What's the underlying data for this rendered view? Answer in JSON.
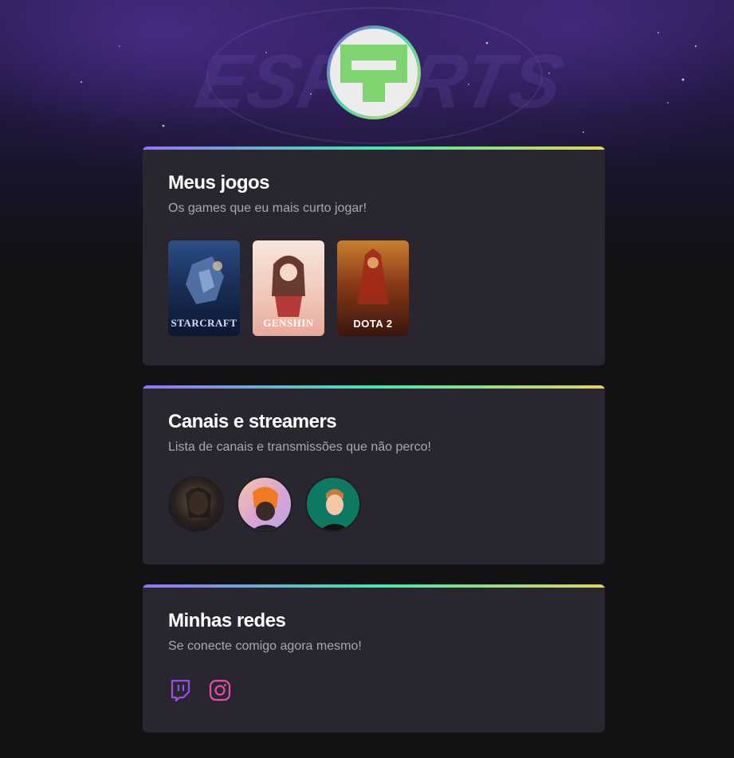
{
  "profile": {
    "avatar_icon": "pin-logo-icon",
    "brand_color": "#7ed56f"
  },
  "sections": {
    "games": {
      "title": "Meus jogos",
      "subtitle": "Os games que eu mais curto jogar!",
      "items": [
        {
          "name": "StarCraft II",
          "label": "STARCRAFT",
          "color": "#1b3a6b"
        },
        {
          "name": "Genshin Impact",
          "label": "GENSHIN",
          "color": "#f3d6c9"
        },
        {
          "name": "Dota 2",
          "label": "DOTA 2",
          "color": "#7a2a14"
        }
      ]
    },
    "channels": {
      "title": "Canais e streamers",
      "subtitle": "Lista de canais e transmissões que não perco!",
      "items": [
        {
          "name": "streamer-1",
          "color": "#2a2220"
        },
        {
          "name": "streamer-2",
          "color": "#d8a070"
        },
        {
          "name": "streamer-3",
          "color": "#0f7a63"
        }
      ]
    },
    "socials": {
      "title": "Minhas redes",
      "subtitle": "Se conecte comigo agora mesmo!",
      "items": [
        {
          "name": "twitch-icon",
          "color": "#9b4ee8"
        },
        {
          "name": "instagram-icon",
          "color": "#e64bb0"
        }
      ]
    }
  },
  "gradient_border": [
    "#9572fc",
    "#43e7ad",
    "#e2d45c"
  ]
}
